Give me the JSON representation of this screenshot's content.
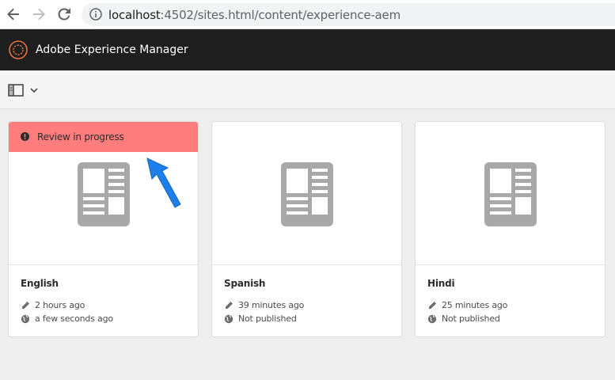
{
  "browser": {
    "url_host": "localhost",
    "url_path": ":4502/sites.html/content/experience-aem"
  },
  "shell": {
    "title": "Adobe Experience Manager"
  },
  "cards": [
    {
      "title": "English",
      "modified": "2 hours ago",
      "published": "a few seconds ago",
      "alert": "Review in progress"
    },
    {
      "title": "Spanish",
      "modified": "39 minutes ago",
      "published": "Not published"
    },
    {
      "title": "Hindi",
      "modified": "25 minutes ago",
      "published": "Not published"
    }
  ],
  "colors": {
    "alert_bg": "#ff7d7d",
    "shell_bg": "#1e1e1e",
    "annotation_arrow": "#1f7fea"
  },
  "icons": [
    "back-arrow-icon",
    "forward-arrow-icon",
    "reload-icon",
    "info-icon",
    "aem-logo-icon",
    "rail-toggle-icon",
    "chevron-down-icon",
    "page-icon",
    "pencil-icon",
    "globe-icon",
    "alert-icon"
  ]
}
